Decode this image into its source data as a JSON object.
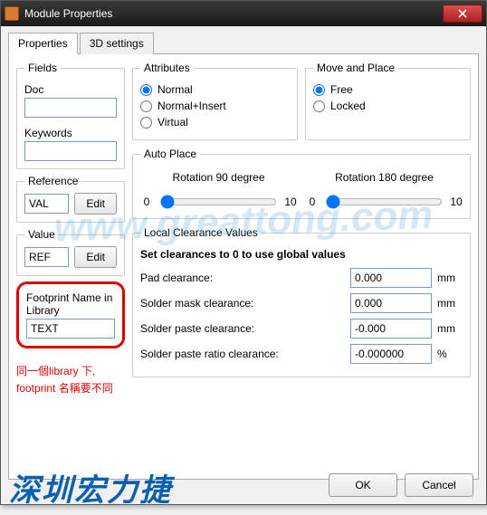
{
  "window": {
    "title": "Module Properties"
  },
  "tabs": {
    "properties": "Properties",
    "settings3d": "3D settings"
  },
  "fields": {
    "legend": "Fields",
    "doc_label": "Doc",
    "doc_value": "",
    "keywords_label": "Keywords",
    "keywords_value": ""
  },
  "reference": {
    "legend": "Reference",
    "value": "VAL",
    "edit": "Edit"
  },
  "valuebox": {
    "legend": "Value",
    "value": "REF",
    "edit": "Edit"
  },
  "footprint": {
    "label": "Footprint Name in Library",
    "value": "TEXT"
  },
  "attributes": {
    "legend": "Attributes",
    "normal": "Normal",
    "normal_insert": "Normal+Insert",
    "virtual": "Virtual"
  },
  "moveplace": {
    "legend": "Move and Place",
    "free": "Free",
    "locked": "Locked"
  },
  "autoplace": {
    "legend": "Auto Place",
    "rot90_label": "Rotation 90 degree",
    "rot180_label": "Rotation 180 degree",
    "min": "0",
    "max": "10",
    "rot90_value": "0",
    "rot180_value": "0"
  },
  "clearances": {
    "legend": "Local Clearance Values",
    "hint": "Set clearances to 0 to use global values",
    "pad_label": "Pad clearance:",
    "pad_value": "0.000",
    "mask_label": "Solder mask clearance:",
    "mask_value": "0.000",
    "paste_label": "Solder paste clearance:",
    "paste_value": "-0.000",
    "ratio_label": "Solder paste ratio clearance:",
    "ratio_value": "-0.000000",
    "mm": "mm",
    "pct": "%"
  },
  "buttons": {
    "ok": "OK",
    "cancel": "Cancel"
  },
  "annotation": {
    "line1": "同一個library 下,",
    "line2": "footprint 名稱要不同"
  },
  "watermark": {
    "url": "www.greattong.com",
    "brand": "深圳宏力捷"
  }
}
